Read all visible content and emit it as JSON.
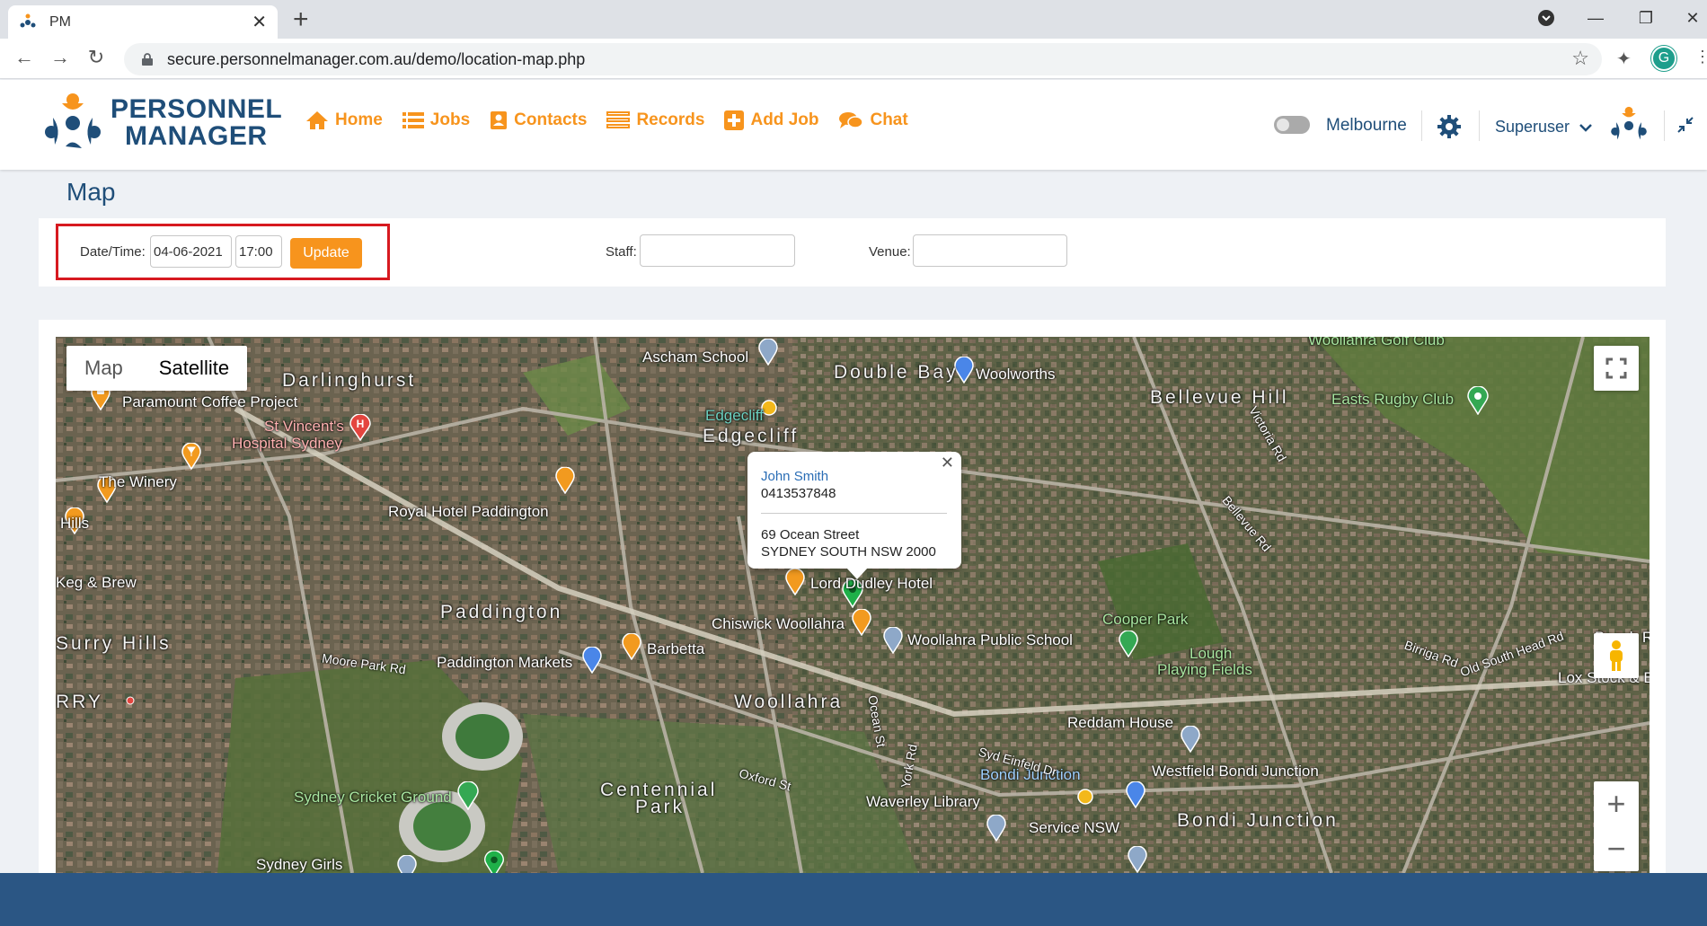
{
  "browser": {
    "tab_title": "PM",
    "url": "secure.personnelmanager.com.au/demo/location-map.php",
    "profile_initial": "G"
  },
  "app": {
    "logo": {
      "line1": "PERSONNEL",
      "line2": "MANAGER"
    },
    "nav": [
      {
        "label": "Home",
        "icon": "home-icon"
      },
      {
        "label": "Jobs",
        "icon": "list-icon"
      },
      {
        "label": "Contacts",
        "icon": "contact-icon"
      },
      {
        "label": "Records",
        "icon": "records-icon"
      },
      {
        "label": "Add Job",
        "icon": "plus-square-icon"
      },
      {
        "label": "Chat",
        "icon": "chat-icon"
      }
    ],
    "location": "Melbourne",
    "user": "Superuser",
    "accent_color": "#f7941d",
    "brand_color": "#1f4e79"
  },
  "page": {
    "title": "Map",
    "filters": {
      "datetime_label": "Date/Time:",
      "date_value": "04-06-2021",
      "time_value": "17:00",
      "update_label": "Update",
      "staff_label": "Staff:",
      "staff_value": "",
      "venue_label": "Venue:",
      "venue_value": ""
    }
  },
  "map": {
    "type_options": [
      "Map",
      "Satellite"
    ],
    "selected_type": "Satellite",
    "labels": {
      "darlinghurst": "Darlinghurst",
      "paramount": "Paramount Coffee Project",
      "st_vincents_1": "St Vincent's",
      "st_vincents_2": "Hospital Sydney",
      "winery": "The Winery",
      "hills": "Hills",
      "keg": "Keg & Brew",
      "surry_hills": "Surry Hills",
      "rry": "RRY",
      "royal_hotel": "Royal Hotel Paddington",
      "paddington": "Paddington",
      "paddington_markets": "Paddington Markets",
      "barbetta": "Barbetta",
      "ascham": "Ascham School",
      "double_bay": "Double Bay",
      "woolworths": "Woolworths",
      "edgecliff": "Edgecliff",
      "edgecliff_big": "Edgecliff",
      "bellevue_hill": "Bellevue Hill",
      "easts_rugby": "Easts Rugby Club",
      "golf": "Woollahra Golf Club",
      "lord_dudley": "Lord Dudley Hotel",
      "chiswick": "Chiswick Woollahra",
      "woollahra_school": "Woollahra Public School",
      "cooper_park": "Cooper Park",
      "lough_1": "Lough",
      "lough_2": "Playing Fields",
      "woollahra": "Woollahra",
      "reddam": "Reddam House",
      "bondi_junction_stn": "Bondi Junction",
      "westfield": "Westfield Bondi Junction",
      "bondi_junction": "Bondi Junction",
      "waverley_library": "Waverley Library",
      "service_nsw": "Service NSW",
      "centennial_1": "Centennial",
      "centennial_2": "Park",
      "scg": "Sydney Cricket Ground",
      "sydney_girls": "Sydney Girls",
      "beach_rd": "Beach Ro",
      "lox_stock": "Lox Stock & B",
      "moore_park_rd": "Moore Park Rd",
      "oxford_st": "Oxford St",
      "ocean_st": "Ocean St",
      "syd_einfeld": "Syd Einfeld Dr",
      "old_south_head": "Old South Head Rd",
      "victoria_rd": "Victoria Rd",
      "bellevue_rd": "Bellevue Rd",
      "birriga_rd": "Birriga Rd",
      "york_rd": "York Rd"
    },
    "info_window": {
      "name": "John Smith",
      "phone": "0413537848",
      "address_line1": "69 Ocean Street",
      "address_line2": "SYDNEY SOUTH NSW 2000"
    }
  }
}
